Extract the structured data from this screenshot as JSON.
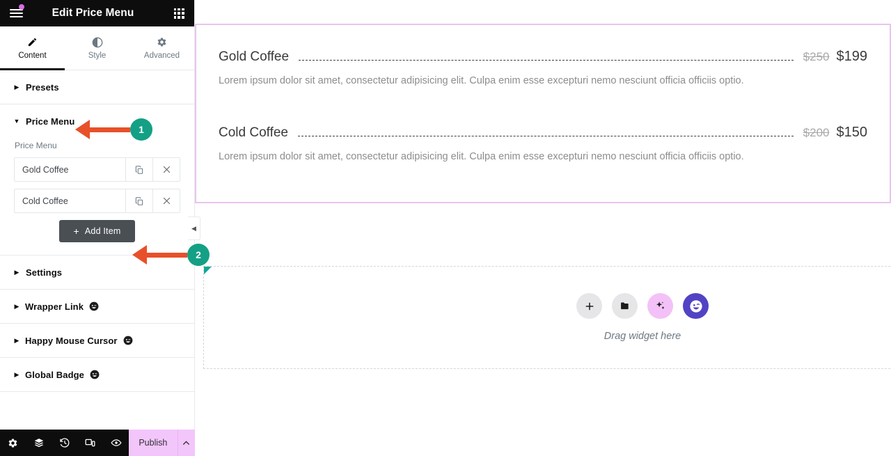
{
  "panel": {
    "header": {
      "title": "Edit Price Menu",
      "menu_icon": "hamburger-menu-icon",
      "notification_dot_color": "#d76ee0",
      "widgets_panel_icon": "grid-3x3-icon"
    },
    "tabs": [
      {
        "label": "Content",
        "icon": "pencil-icon",
        "active": true
      },
      {
        "label": "Style",
        "icon": "half-circle-contrast-icon",
        "active": false
      },
      {
        "label": "Advanced",
        "icon": "gear-icon",
        "active": false
      }
    ],
    "sections": [
      {
        "label": "Presets",
        "expanded": false,
        "has_happy_icon": false
      },
      {
        "label": "Price Menu",
        "expanded": true,
        "has_happy_icon": false
      },
      {
        "label": "Settings",
        "expanded": false,
        "has_happy_icon": false
      },
      {
        "label": "Wrapper Link",
        "expanded": false,
        "has_happy_icon": true
      },
      {
        "label": "Happy Mouse Cursor",
        "expanded": false,
        "has_happy_icon": true
      },
      {
        "label": "Global Badge",
        "expanded": false,
        "has_happy_icon": true
      }
    ],
    "price_menu": {
      "field_label": "Price Menu",
      "items": [
        {
          "title": "Gold Coffee",
          "duplicate_icon": "copy-icon",
          "remove_icon": "close-x-icon"
        },
        {
          "title": "Cold Coffee",
          "duplicate_icon": "copy-icon",
          "remove_icon": "close-x-icon"
        }
      ],
      "add_button": {
        "label": "Add Item",
        "plus": "+"
      }
    },
    "footer": {
      "icons": [
        "gear-icon",
        "layers-navigator-icon",
        "history-revisions-icon",
        "responsive-mode-icon",
        "eye-preview-icon"
      ],
      "publish_label": "Publish",
      "publish_bg": "#f3c6fb",
      "caret_icon": "chevron-up-icon"
    },
    "collapse_handle_icon": "chevron-left-icon"
  },
  "canvas": {
    "selection_border_color": "#e8c4ec",
    "price_items": [
      {
        "title": "Gold Coffee",
        "price_old": "$250",
        "price_new": "$199",
        "description": "Lorem ipsum dolor sit amet, consectetur adipisicing elit. Culpa enim esse excepturi nemo nesciunt officia officiis optio."
      },
      {
        "title": "Cold Coffee",
        "price_old": "$200",
        "price_new": "$150",
        "description": "Lorem ipsum dolor sit amet, consectetur adipisicing elit. Culpa enim esse excepturi nemo nesciunt officia officiis optio."
      }
    ],
    "dropzone": {
      "label": "Drag widget here",
      "buttons": [
        {
          "icon": "plus-icon",
          "style": "gray"
        },
        {
          "icon": "folder-icon",
          "style": "gray"
        },
        {
          "icon": "ai-sparkles-icon",
          "style": "pink"
        },
        {
          "icon": "happy-addons-face-icon",
          "style": "purple"
        }
      ]
    }
  },
  "annotations": {
    "arrow_color": "#e8502a",
    "badge_color": "#14a085",
    "items": [
      {
        "number": "1",
        "target": "price-menu-section-header"
      },
      {
        "number": "2",
        "target": "add-item-button"
      }
    ]
  }
}
